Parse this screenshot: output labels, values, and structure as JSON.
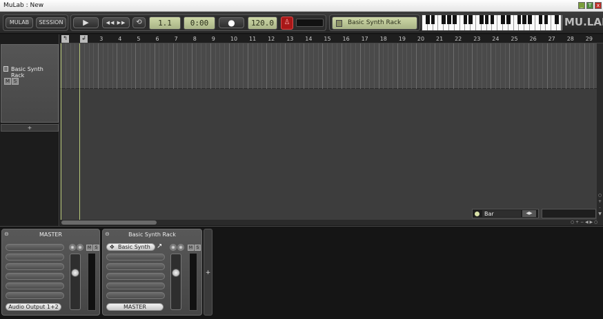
{
  "window": {
    "title": "MuLab : New",
    "buttons": [
      "_",
      "T",
      "x"
    ]
  },
  "toolbar": {
    "mulab_label": "MULAB",
    "session_label": "SESSION",
    "play_glyph": "▶",
    "rewind_glyph": "◀◀",
    "forward_glyph": "▶▶",
    "loop_glyph": "⟲",
    "position": "1.1",
    "time": "0:00",
    "record_glyph": "●",
    "tempo": "120.0",
    "metronome_glyph": "♙",
    "focus_rack": "Basic Synth Rack",
    "logo": "MU.LAB"
  },
  "tracks": [
    {
      "name": "Basic Synth Rack",
      "mute": "M",
      "solo": "S"
    }
  ],
  "add_track_label": "+",
  "ruler": {
    "bars": [
      "1",
      "2",
      "3",
      "4",
      "5",
      "6",
      "7",
      "8",
      "9",
      "10",
      "11",
      "12",
      "13",
      "14",
      "15",
      "16",
      "17",
      "18",
      "19",
      "20",
      "21",
      "22",
      "23",
      "24",
      "25",
      "26",
      "27",
      "28",
      "29"
    ]
  },
  "snap": {
    "value": "Bar"
  },
  "mixer": {
    "strips": [
      {
        "title": "MASTER",
        "mute": "M",
        "solo": "S",
        "plugin": "",
        "output": "Audio Output 1+2"
      },
      {
        "title": "Basic Synth Rack",
        "mute": "M",
        "solo": "S",
        "plugin": "Basic Synth",
        "output": "MASTER"
      }
    ],
    "add_label": "+"
  },
  "colors": {
    "lcd": "#b9c495",
    "accent_line": "#b8c87a",
    "record_red": "#b51c1c"
  }
}
